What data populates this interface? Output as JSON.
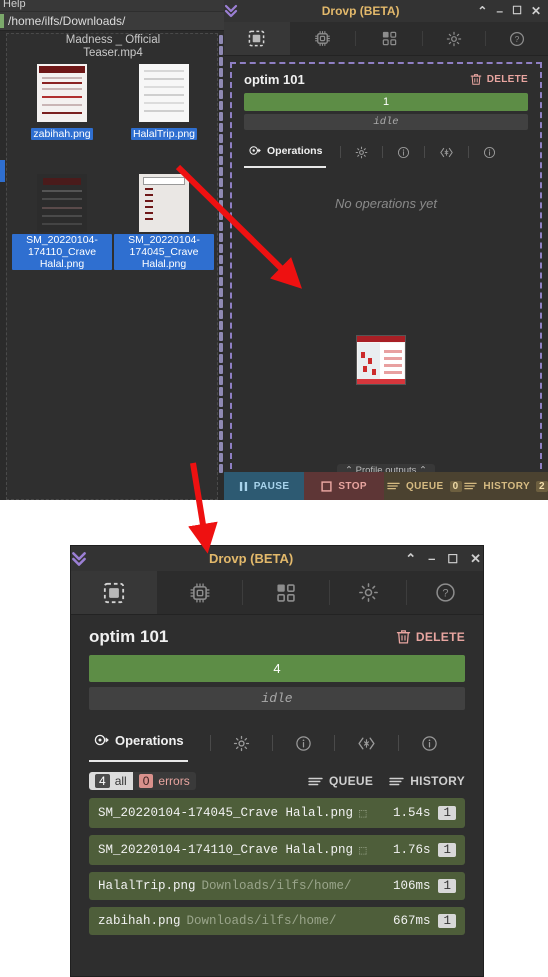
{
  "file_manager": {
    "menu_hint": "Help",
    "path": "/home/ilfs/Downloads/",
    "truncated_top_label_line1": "Madness _ Official",
    "truncated_top_label_line2": "Teaser.mp4",
    "files": [
      {
        "name": "zabihah.png",
        "selected": true
      },
      {
        "name": "HalalTrip.png",
        "selected": true
      },
      {
        "name": "SM_20220104-174110_Crave Halal.png",
        "selected": true
      },
      {
        "name": "SM_20220104-174045_Crave Halal.png",
        "selected": true
      }
    ]
  },
  "window_top": {
    "title": "Drovp (BETA)",
    "logo_icon": "chevrons-down-icon",
    "controls": [
      {
        "name": "collapse-button",
        "glyph": "⌃"
      },
      {
        "name": "minimize-button",
        "glyph": "–"
      },
      {
        "name": "maximize-button",
        "glyph": "☐"
      },
      {
        "name": "close-button",
        "glyph": "✕"
      }
    ],
    "tabs": [
      {
        "name": "tab-drop-zone",
        "icon": "dashed-square-icon",
        "active": true
      },
      {
        "name": "tab-processors",
        "icon": "chip-icon",
        "active": false
      },
      {
        "name": "tab-plugins",
        "icon": "grid-blocks-icon",
        "active": false
      },
      {
        "name": "tab-settings",
        "icon": "gear-icon",
        "active": false
      },
      {
        "name": "tab-help",
        "icon": "question-circle-icon",
        "active": false
      }
    ],
    "profile": {
      "title": "optim 101",
      "delete_label": "DELETE",
      "delete_icon": "trash-icon",
      "progress_value": "1",
      "status": "idle"
    },
    "subtabs": [
      {
        "name": "subtab-operations",
        "label": "Operations",
        "icon": "operations-icon",
        "active": true
      },
      {
        "name": "subtab-options",
        "label": "",
        "icon": "gear-icon",
        "active": false
      },
      {
        "name": "subtab-details",
        "label": "",
        "icon": "info-circle-icon",
        "active": false
      },
      {
        "name": "subtab-dependencies",
        "label": "",
        "icon": "code-icon",
        "active": false
      },
      {
        "name": "subtab-about",
        "label": "",
        "icon": "info-circle-icon",
        "active": false
      }
    ],
    "empty_message": "No operations yet",
    "profile_outputs_label": "Profile outputs",
    "profile_outputs_chevron": "⌃",
    "bottom_bar": [
      {
        "name": "pause-button",
        "label": "PAUSE",
        "icon": "pause-icon",
        "count": null
      },
      {
        "name": "stop-button",
        "label": "STOP",
        "icon": "stop-icon",
        "count": null
      },
      {
        "name": "queue-button",
        "label": "QUEUE",
        "icon": "lines-icon",
        "count": "0"
      },
      {
        "name": "history-button",
        "label": "HISTORY",
        "icon": "lines-icon",
        "count": "2"
      }
    ]
  },
  "window_bottom": {
    "title": "Drovp (BETA)",
    "logo_icon": "chevrons-down-icon",
    "controls": [
      {
        "name": "collapse-button",
        "glyph": "⌃"
      },
      {
        "name": "minimize-button",
        "glyph": "–"
      },
      {
        "name": "maximize-button",
        "glyph": "☐"
      },
      {
        "name": "close-button",
        "glyph": "✕"
      }
    ],
    "tabs": [
      {
        "name": "tab-drop-zone",
        "icon": "dashed-square-icon",
        "active": true
      },
      {
        "name": "tab-processors",
        "icon": "chip-icon",
        "active": false
      },
      {
        "name": "tab-plugins",
        "icon": "grid-blocks-icon",
        "active": false
      },
      {
        "name": "tab-settings",
        "icon": "gear-icon",
        "active": false
      },
      {
        "name": "tab-help",
        "icon": "question-circle-icon",
        "active": false
      }
    ],
    "profile": {
      "title": "optim 101",
      "delete_label": "DELETE",
      "delete_icon": "trash-icon",
      "progress_value": "4",
      "status": "idle"
    },
    "subtabs": [
      {
        "name": "subtab-operations",
        "label": "Operations",
        "icon": "operations-icon",
        "active": true
      },
      {
        "name": "subtab-options",
        "label": "",
        "icon": "gear-icon",
        "active": false
      },
      {
        "name": "subtab-details",
        "label": "",
        "icon": "info-circle-icon",
        "active": false
      },
      {
        "name": "subtab-dependencies",
        "label": "",
        "icon": "code-icon",
        "active": false
      },
      {
        "name": "subtab-about",
        "label": "",
        "icon": "info-circle-icon",
        "active": false
      }
    ],
    "filters": {
      "all_count": "4",
      "all_label": "all",
      "errors_count": "0",
      "errors_label": "errors",
      "queue_label": "QUEUE",
      "history_label": "HISTORY"
    },
    "operations": [
      {
        "file": "SM_20220104-174045_Crave Halal.png",
        "path": "⬚",
        "duration": "1.54s",
        "badge": "1"
      },
      {
        "file": "SM_20220104-174110_Crave Halal.png",
        "path": "⬚",
        "duration": "1.76s",
        "badge": "1"
      },
      {
        "file": "HalalTrip.png",
        "path": "Downloads/ilfs/home/",
        "duration": "106ms",
        "badge": "1"
      },
      {
        "file": "zabihah.png",
        "path": "Downloads/ilfs/home/",
        "duration": "667ms",
        "badge": "1"
      }
    ]
  },
  "annotations": {
    "arrow_color": "#ee1111",
    "arrow_1": "arrow-pointing-to-drop-zone",
    "arrow_2": "arrow-pointing-to-second-window"
  },
  "colors": {
    "accent_purple": "#8f7fc4",
    "title_gold": "#e3b96b",
    "progress_green": "#5d8d46",
    "row_green": "#4e5e3a",
    "selection_blue": "#2f6fd0",
    "danger": "#e8a5a0"
  }
}
